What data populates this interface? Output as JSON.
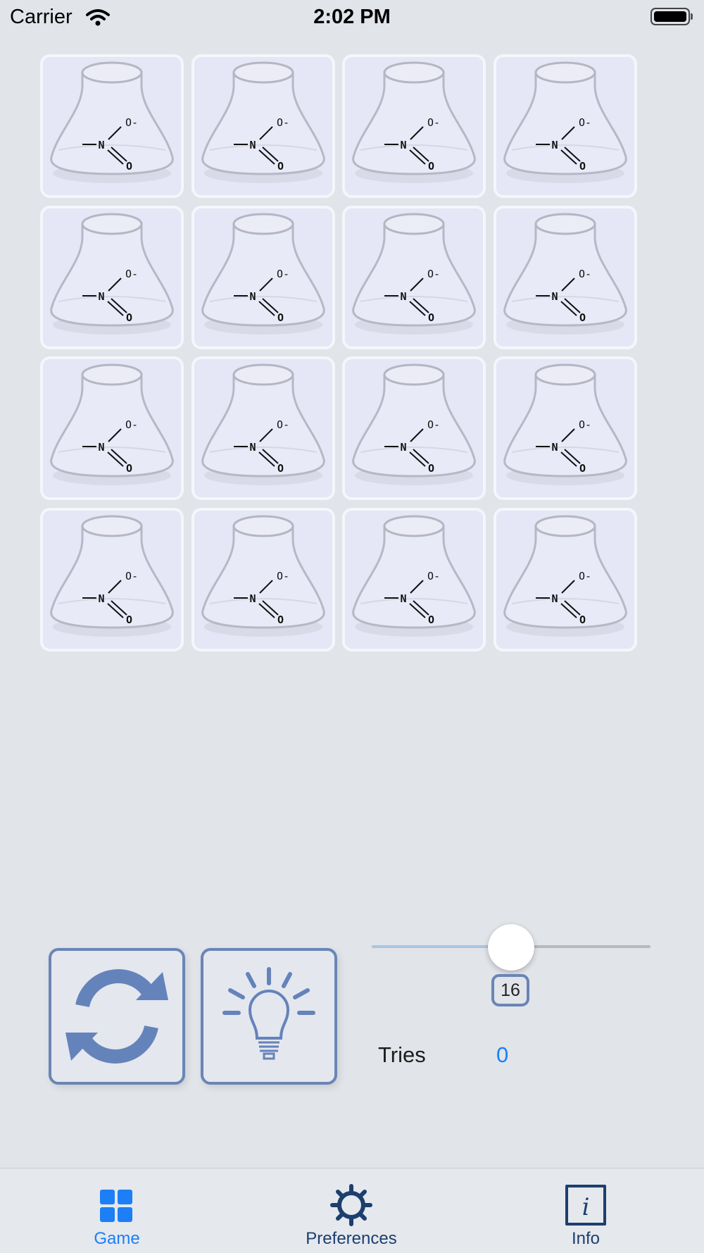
{
  "status_bar": {
    "carrier": "Carrier",
    "time": "2:02 PM",
    "icons": [
      "wifi-icon",
      "battery-icon"
    ]
  },
  "game_board": {
    "card_count": 16,
    "columns": 4,
    "card_back": {
      "icon": "erlenmeyer-flask-icon",
      "formula_atoms": {
        "nitrogen": "N",
        "oxide": "O-",
        "oxygen": "O"
      }
    },
    "colors": {
      "card_fill": "#e5e6f6",
      "card_border": "#f5f6fb"
    }
  },
  "controls": {
    "restart_icon": "restart-icon",
    "hint_icon": "lightbulb-icon",
    "pair_slider": {
      "fraction": 0.5
    },
    "card_count_label": "16",
    "tries_label": "Tries",
    "tries_value": "0",
    "colors": {
      "accent": "#6a85b6",
      "link_blue": "#1c7ff6"
    }
  },
  "tab_bar": {
    "tabs": [
      {
        "label": "Game",
        "icon": "grid-icon",
        "selected": true
      },
      {
        "label": "Preferences",
        "icon": "gear-icon",
        "selected": false
      },
      {
        "label": "Info",
        "icon": "info-icon",
        "selected": false
      }
    ],
    "colors": {
      "selected": "#1c7ff6",
      "unselected": "#1c3f6e"
    }
  }
}
